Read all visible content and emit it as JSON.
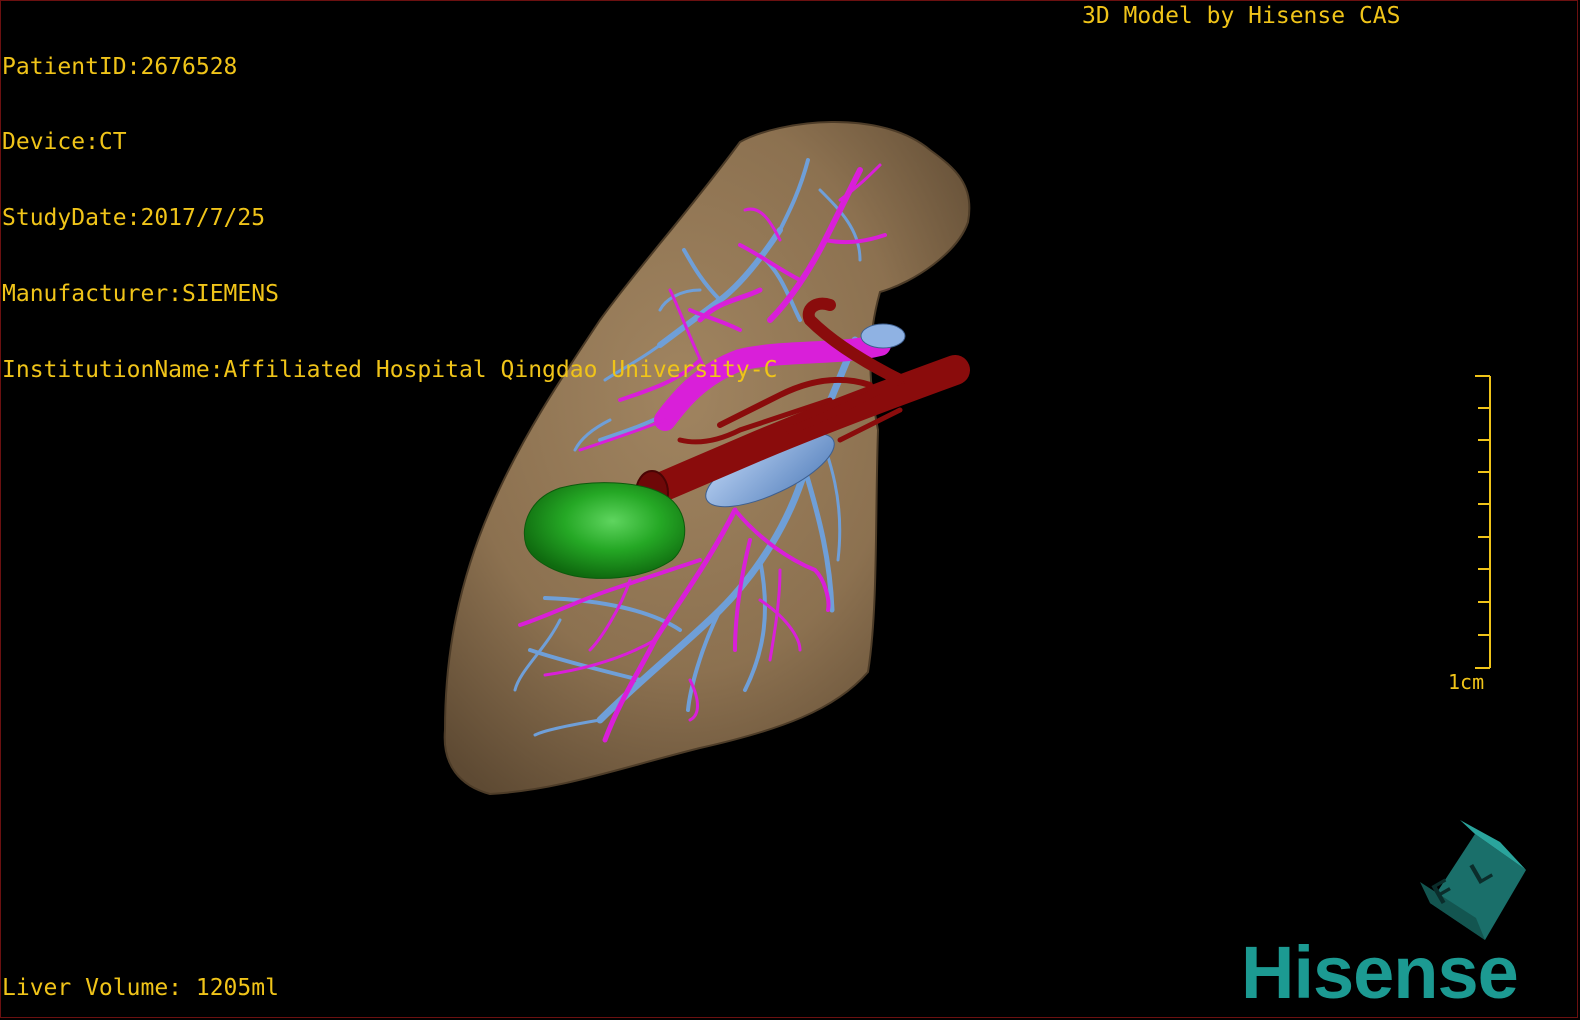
{
  "info_lines": [
    "PatientID:2676528",
    "Device:CT",
    "StudyDate:2017/7/25",
    "Manufacturer:SIEMENS",
    "InstitutionName:Affiliated Hospital Qingdao University-C"
  ],
  "title": "3D Model by Hisense CAS",
  "volume": "Liver Volume: 1205ml",
  "scale_label": "1cm",
  "brand": "Hisense",
  "logo_letters": "F L",
  "colors": {
    "text": "#f0c419",
    "liver": "#8c7150",
    "portal_vein": "#d91fd9",
    "hepatic_vein": "#6f9fd8",
    "artery": "#8a0c0c",
    "tumor": "#1fa31f",
    "brand": "#1c9a92"
  }
}
